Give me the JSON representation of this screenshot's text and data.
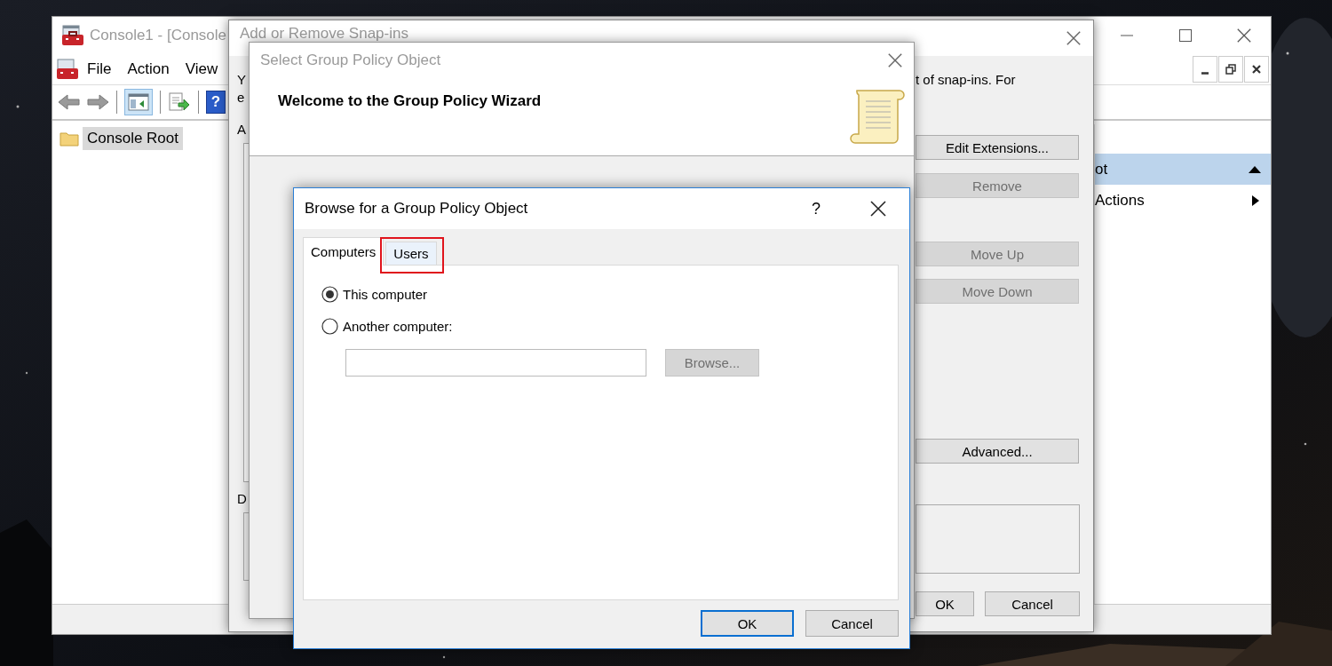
{
  "console_window": {
    "title": "Console1 - [Console",
    "menu": [
      "File",
      "Action",
      "View"
    ],
    "toolbar_help": "?",
    "tree": [
      {
        "label": "Console Root",
        "selected": true
      }
    ],
    "actions_pane": {
      "header": "ot",
      "items": [
        "Actions"
      ]
    }
  },
  "snapins_window": {
    "title": "Add or Remove Snap-ins",
    "intro_left": [
      "Y",
      "e"
    ],
    "intro_right": "t of snap-ins. For",
    "label_top": "A",
    "label_bottom": "D",
    "buttons": [
      {
        "label": "Edit Extensions...",
        "disabled": false
      },
      {
        "label": "Remove",
        "disabled": true
      },
      {
        "label": "Move Up",
        "disabled": true
      },
      {
        "label": "Move Down",
        "disabled": true
      },
      {
        "label": "Advanced...",
        "disabled": false
      }
    ],
    "footer_buttons": [
      "OK",
      "Cancel"
    ]
  },
  "gpo_wizard": {
    "title": "Select Group Policy Object",
    "heading": "Welcome to the Group Policy Wizard"
  },
  "browse_dialog": {
    "title": "Browse for a Group Policy Object",
    "help": "?",
    "tabs": [
      {
        "label": "Computers",
        "selected": true,
        "highlighted": false
      },
      {
        "label": "Users",
        "selected": false,
        "highlighted": true
      }
    ],
    "options": [
      {
        "label": "This computer",
        "selected": true
      },
      {
        "label": "Another computer:",
        "selected": false
      }
    ],
    "browse_button": {
      "label": "Browse...",
      "disabled": true
    },
    "buttons": [
      {
        "label": "OK",
        "default": true
      },
      {
        "label": "Cancel",
        "default": false
      }
    ]
  }
}
